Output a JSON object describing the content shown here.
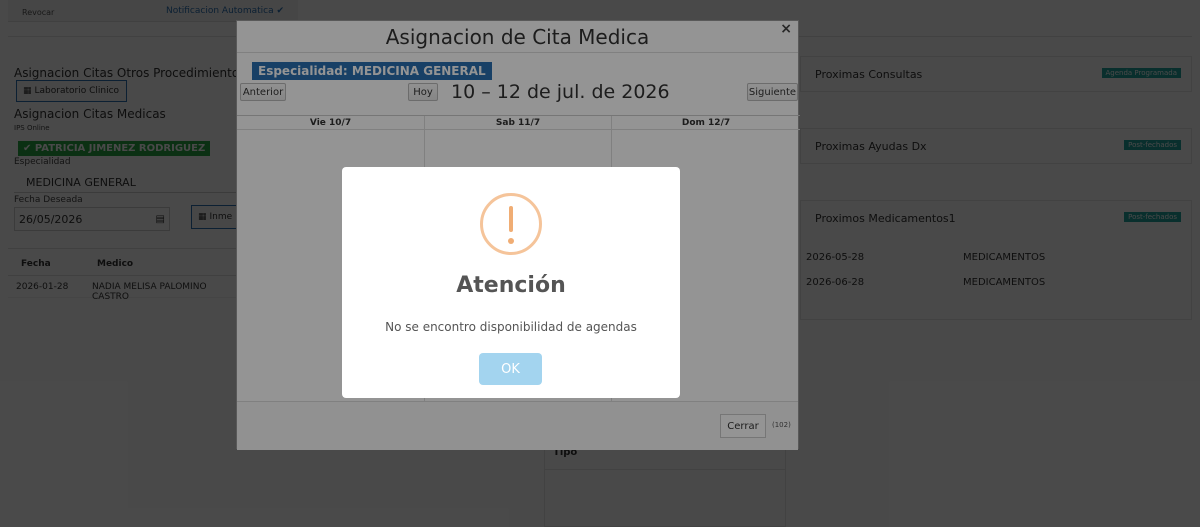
{
  "topbar": {
    "revocar": "Revocar",
    "notificacion": "Notificacion Automatica ✔"
  },
  "left": {
    "otros_title": "Asignacion Citas Otros Procedimientos",
    "lab_button": "Laboratorio Clinico",
    "medicas_title": "Asignacion Citas Medicas",
    "ips": "IPS Online",
    "patient": "✔ PATRICIA JIMENEZ RODRIGUEZ",
    "especialidad_label": "Especialidad",
    "especialidad_value": "MEDICINA GENERAL",
    "fecha_label": "Fecha Deseada",
    "fecha_value": "26/05/2026",
    "inmed_button": "Inme"
  },
  "table": {
    "headers": [
      "Fecha",
      "Medico"
    ],
    "rows": [
      [
        "2026-01-28",
        "NADIA MELISA PALOMINO CASTRO"
      ]
    ]
  },
  "right": {
    "panels": [
      {
        "title": "Proximas Consultas",
        "badge": "Agenda Programada"
      },
      {
        "title": "Proximas Ayudas Dx",
        "badge": "Post-fechados"
      },
      {
        "title": "Proximos Medicamentos1",
        "badge": "Post-fechados"
      }
    ],
    "med_rows": [
      [
        "2026-05-28",
        "MEDICAMENTOS"
      ],
      [
        "2026-06-28",
        "MEDICAMENTOS"
      ]
    ]
  },
  "tipo_label": "Tipo",
  "modal": {
    "title": "Asignacion de Cita Medica",
    "close": "×",
    "specialty": "Especialidad: MEDICINA GENERAL",
    "prev": "Anterior",
    "today": "Hoy",
    "next": "Siguiente",
    "range": "10 – 12 de jul. de 2026",
    "days": [
      "Vie 10/7",
      "Sab 11/7",
      "Dom 12/7"
    ],
    "close_button": "Cerrar",
    "count": "(102)"
  },
  "alert": {
    "title": "Atención",
    "message": "No se encontro disponibilidad de agendas",
    "ok": "OK"
  }
}
